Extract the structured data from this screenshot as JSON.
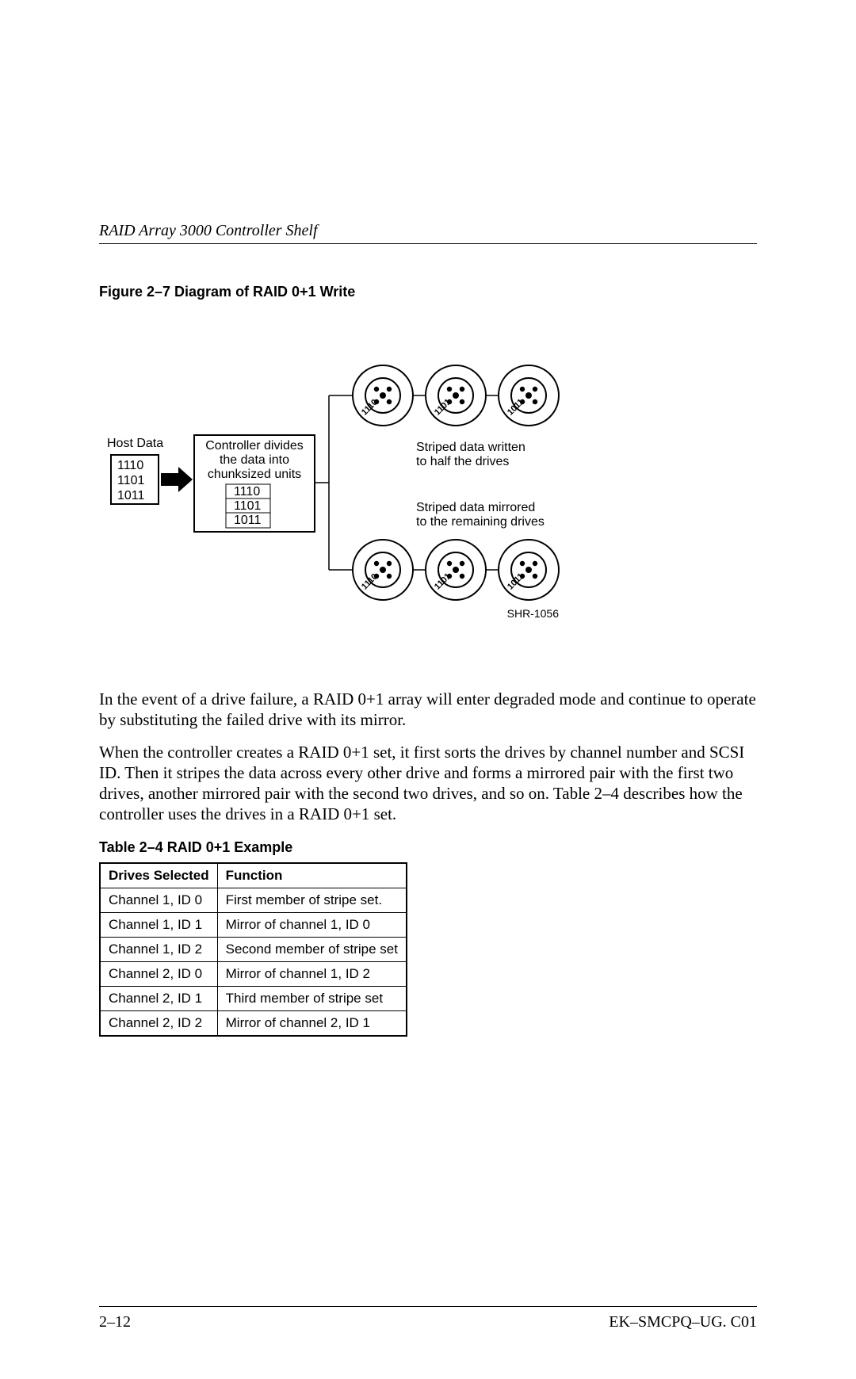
{
  "header": {
    "running_head": "RAID Array 3000 Controller Shelf"
  },
  "figure": {
    "title": "Figure 2–7  Diagram of RAID 0+1 Write",
    "host_label": "Host Data",
    "host_bits": [
      "1110",
      "1101",
      "1011"
    ],
    "controller_lines": [
      "Controller divides",
      "the data into",
      "chunksized units"
    ],
    "controller_bits": [
      "1110",
      "1101",
      "1011"
    ],
    "text_top_lines": [
      "Striped data written",
      "to half the drives"
    ],
    "text_bot_lines": [
      "Striped data mirrored",
      "to the remaining drives"
    ],
    "disk_bits": [
      "1110",
      "1101",
      "1011"
    ],
    "artwork_id": "SHR-1056"
  },
  "paragraphs": {
    "p1": "In the event of a drive failure, a RAID 0+1 array will enter degraded mode and continue to operate by substituting the failed drive with its mirror.",
    "p2": "When the controller creates a RAID 0+1 set, it first sorts the drives by channel number and SCSI ID. Then it stripes the data across every other drive and forms a mirrored pair with the first two drives, another mirrored pair with the second two drives, and so on. Table 2–4 describes how the controller uses the drives in a RAID 0+1 set."
  },
  "table": {
    "title": "Table 2–4  RAID 0+1 Example",
    "headers": [
      "Drives Selected",
      "Function"
    ],
    "rows": [
      [
        "Channel 1, ID 0",
        "First member of stripe set."
      ],
      [
        "Channel 1, ID 1",
        "Mirror of channel 1, ID 0"
      ],
      [
        "Channel 1, ID 2",
        "Second member of stripe set"
      ],
      [
        "Channel 2, ID 0",
        "Mirror of channel 1, ID 2"
      ],
      [
        "Channel 2, ID 1",
        "Third member of stripe set"
      ],
      [
        "Channel 2, ID 2",
        "Mirror of channel 2, ID 1"
      ]
    ]
  },
  "footer": {
    "left": "2–12",
    "right": "EK–SMCPQ–UG. C01"
  }
}
